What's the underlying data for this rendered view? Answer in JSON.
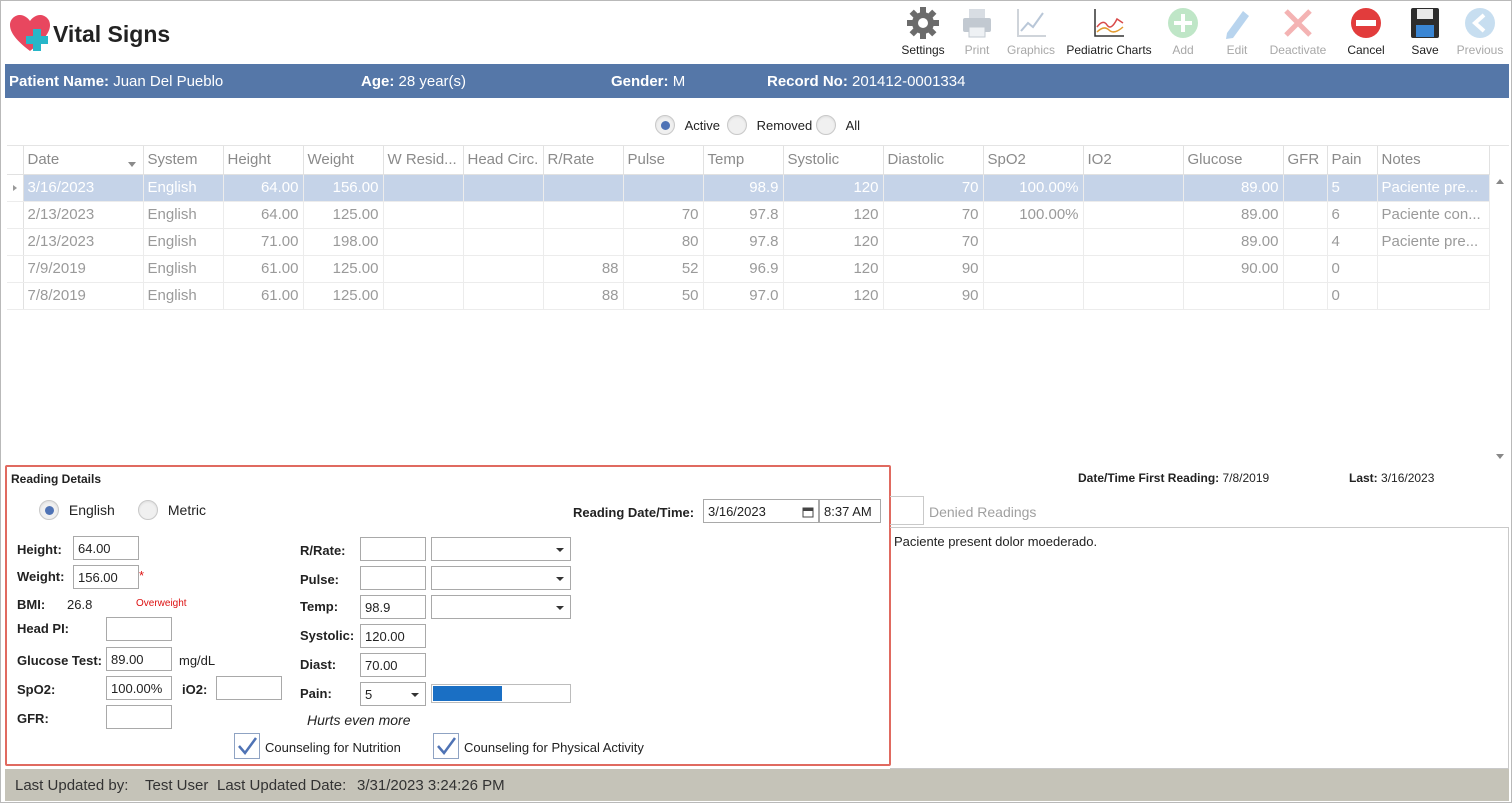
{
  "app": {
    "title": "Vital Signs"
  },
  "toolbar": [
    {
      "label": "Settings",
      "icon": "gear-icon",
      "enabled": true
    },
    {
      "label": "Print",
      "icon": "printer-icon",
      "enabled": false
    },
    {
      "label": "Graphics",
      "icon": "line-chart-icon",
      "enabled": false
    },
    {
      "label": "Pediatric Charts",
      "icon": "pediatric-chart-icon",
      "enabled": true
    },
    {
      "label": "Add",
      "icon": "add-circle-icon",
      "enabled": false
    },
    {
      "label": "Edit",
      "icon": "pencil-icon",
      "enabled": false
    },
    {
      "label": "Deactivate",
      "icon": "x-mark-icon",
      "enabled": false
    },
    {
      "label": "Cancel",
      "icon": "cancel-icon",
      "enabled": true
    },
    {
      "label": "Save",
      "icon": "floppy-disk-icon",
      "enabled": true
    },
    {
      "label": "Previous",
      "icon": "arrow-left-circle-icon",
      "enabled": false
    }
  ],
  "patient": {
    "name_label": "Patient Name:",
    "name": "Juan Del Pueblo",
    "age_label": "Age:",
    "age": "28 year(s)",
    "gender_label": "Gender:",
    "gender": "M",
    "record_label": "Record No:",
    "record": "201412-0001334"
  },
  "filter": {
    "active": "Active",
    "removed": "Removed",
    "all": "All",
    "selected": "Active"
  },
  "grid": {
    "columns": [
      "Date",
      "System",
      "Height",
      "Weight",
      "W Resid...",
      "Head Circ.",
      "R/Rate",
      "Pulse",
      "Temp",
      "Systolic",
      "Diastolic",
      "SpO2",
      "IO2",
      "Glucose",
      "GFR",
      "Pain",
      "Notes"
    ],
    "rows": [
      [
        "3/16/2023",
        "English",
        "64.00",
        "156.00",
        "",
        "",
        "",
        "",
        "98.9",
        "120",
        "70",
        "100.00%",
        "",
        "89.00",
        "",
        "5",
        "Paciente pre..."
      ],
      [
        "2/13/2023",
        "English",
        "64.00",
        "125.00",
        "",
        "",
        "",
        "70",
        "97.8",
        "120",
        "70",
        "100.00%",
        "",
        "89.00",
        "",
        "6",
        "Paciente con..."
      ],
      [
        "2/13/2023",
        "English",
        "71.00",
        "198.00",
        "",
        "",
        "",
        "80",
        "97.8",
        "120",
        "70",
        "",
        "",
        "89.00",
        "",
        "4",
        "Paciente pre..."
      ],
      [
        "7/9/2019",
        "English",
        "61.00",
        "125.00",
        "",
        "",
        "88",
        "52",
        "96.9",
        "120",
        "90",
        "",
        "",
        "90.00",
        "",
        "0",
        ""
      ],
      [
        "7/8/2019",
        "English",
        "61.00",
        "125.00",
        "",
        "",
        "88",
        "50",
        "97.0",
        "120",
        "90",
        "",
        "",
        "",
        "",
        "0",
        ""
      ]
    ]
  },
  "details": {
    "section_title": "Reading Details",
    "system_english": "English",
    "system_metric": "Metric",
    "reading_dt_label": "Reading Date/Time:",
    "reading_date": "3/16/2023",
    "reading_time": "8:37 AM",
    "height_label": "Height:",
    "height": "64.00",
    "weight_label": "Weight:",
    "weight": "156.00",
    "required_mark": "*",
    "bmi_label": "BMI:",
    "bmi": "26.8",
    "bmi_status": "Overweight",
    "headpi_label": "Head PI:",
    "headpi": "",
    "glucose_label": "Glucose Test:",
    "glucose": "89.00",
    "glucose_unit": "mg/dL",
    "spo2_label": "SpO2:",
    "spo2": "100.00%",
    "io2_label": "iO2:",
    "io2": "",
    "gfr_label": "GFR:",
    "gfr": "",
    "rrate_label": "R/Rate:",
    "rrate": "",
    "pulse_label": "Pulse:",
    "pulse": "",
    "temp_label": "Temp:",
    "temp": "98.9",
    "systolic_label": "Systolic:",
    "systolic": "120.00",
    "diast_label": "Diast:",
    "diast": "70.00",
    "pain_label": "Pain:",
    "pain": "5",
    "pain_level": 0.5,
    "pain_desc": "Hurts even more",
    "counsel_nutrition": "Counseling for Nutrition",
    "counsel_activity": "Counseling for Physical Activity"
  },
  "right": {
    "first_reading_label": "Date/Time First Reading:",
    "first_reading": "7/8/2019",
    "last_label": "Last:",
    "last": "3/16/2023",
    "denied_readings": "Denied Readings",
    "note_text": "Paciente present dolor moederado."
  },
  "footer": {
    "updated_by_label": "Last Updated by:",
    "updated_by": "Test User",
    "updated_date_label": "Last Updated Date:",
    "updated_date": "3/31/2023 3:24:26 PM"
  },
  "colors": {
    "patient_bar": "#5577a8",
    "selected_row": "#c5d3e8",
    "highlight_border": "#e06a60",
    "pain_bar": "#1a6fc4",
    "footer": "#c5c3b8"
  }
}
